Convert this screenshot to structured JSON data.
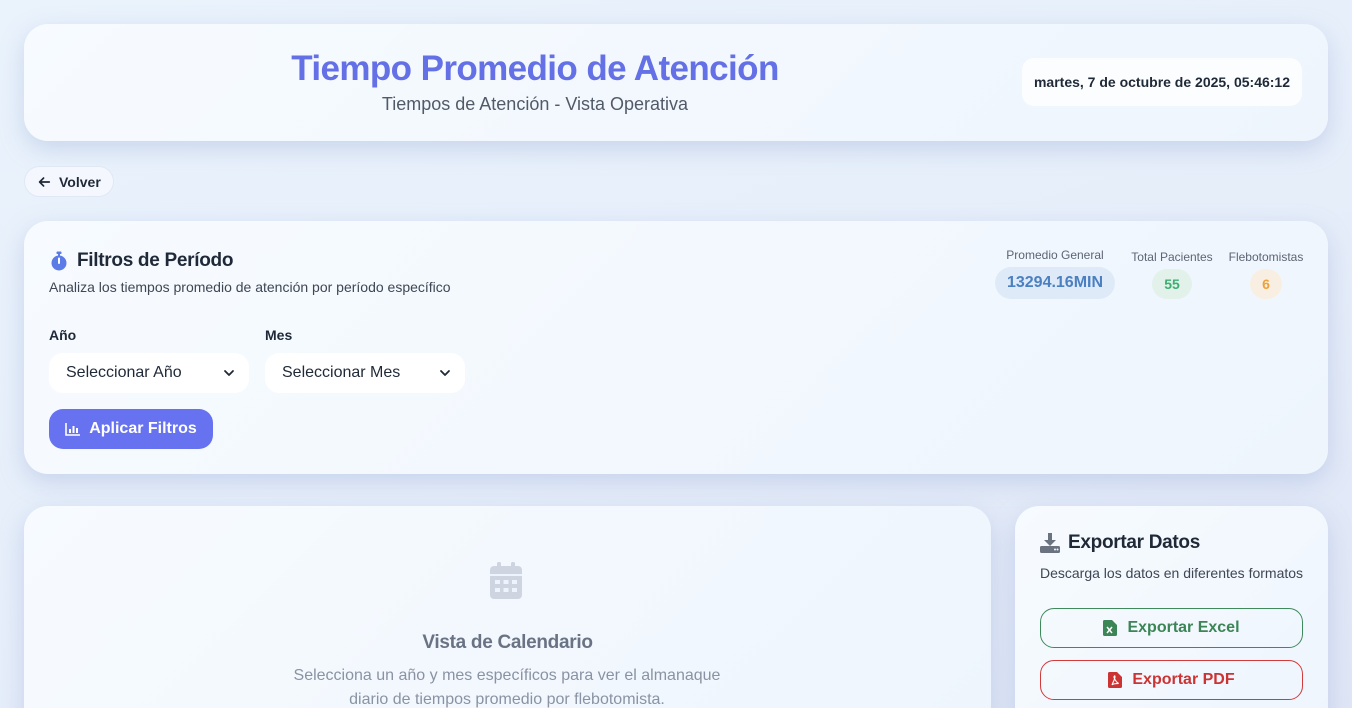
{
  "header": {
    "title": "Tiempo Promedio de Atención",
    "subtitle": "Tiempos de Atención - Vista Operativa",
    "datetime": "martes, 7 de octubre de 2025, 05:46:12"
  },
  "nav": {
    "back_label": "Volver",
    "back_icon": "arrow-left-icon"
  },
  "filters": {
    "icon": "stopwatch-icon",
    "title": "Filtros de Período",
    "description": "Analiza los tiempos promedio de atención por período específico",
    "year_label": "Año",
    "year_value": "Seleccionar Año",
    "month_label": "Mes",
    "month_value": "Seleccionar Mes",
    "apply_label": "Aplicar Filtros",
    "apply_icon": "chart-bar-icon"
  },
  "stats": {
    "general_label": "Promedio General",
    "general_value": "13294.16MIN",
    "patients_label": "Total Pacientes",
    "patients_value": "55",
    "flebo_label": "Flebotomistas",
    "flebo_value": "6"
  },
  "calendar": {
    "icon": "calendar-icon",
    "title": "Vista de Calendario",
    "text": "Selecciona un año y mes específicos para ver el almanaque diario de tiempos promedio por flebotomista."
  },
  "export": {
    "icon": "download-icon",
    "title": "Exportar Datos",
    "description": "Descarga los datos en diferentes formatos",
    "excel_label": "Exportar Excel",
    "excel_icon": "file-excel-icon",
    "pdf_label": "Exportar PDF",
    "pdf_icon": "file-pdf-icon"
  },
  "colors": {
    "accent": "#6672ef",
    "title": "#6470e6",
    "excel": "#3c8557",
    "pdf": "#cc3434",
    "patients": "#3bb071",
    "flebo": "#f0a03a",
    "general": "#4a7fc1"
  }
}
